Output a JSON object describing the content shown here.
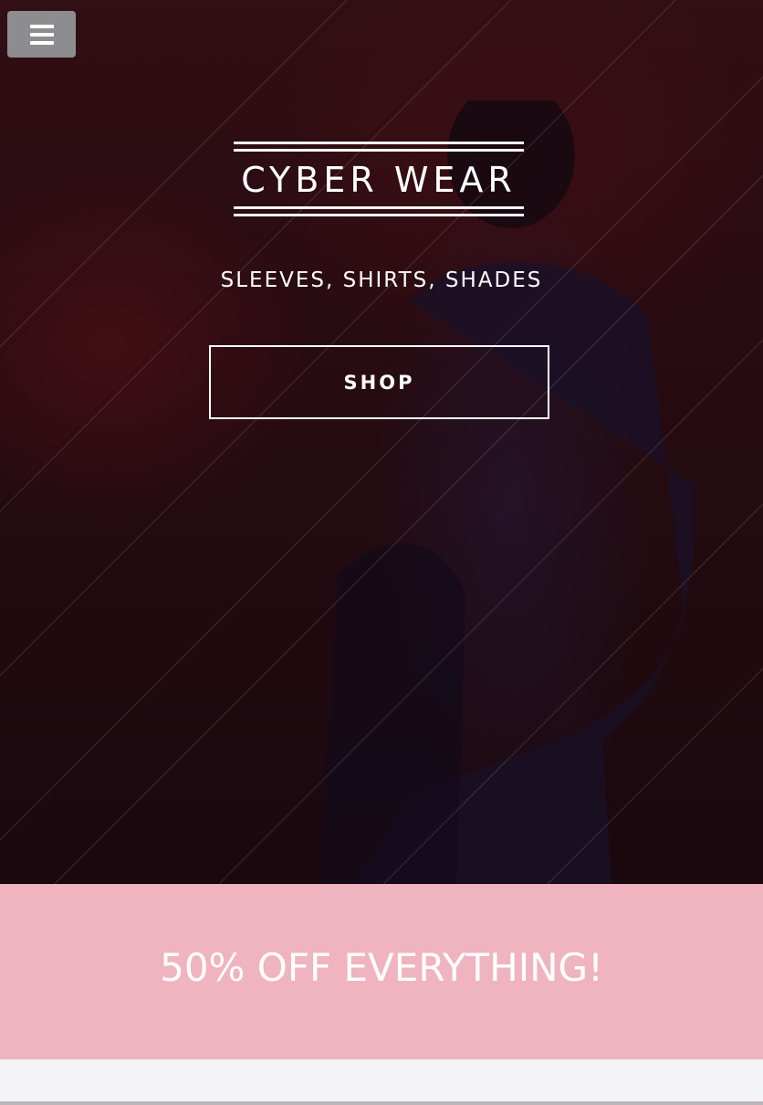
{
  "hero": {
    "brand_title": "CYBER WEAR",
    "tagline": "SLEEVES, SHIRTS, SHADES",
    "shop_label": "SHOP"
  },
  "nav": {
    "menu_icon": "hamburger-menu-icon"
  },
  "promo": {
    "text": "50% OFF EVERYTHING!"
  },
  "colors": {
    "hero_background": "#2c0e14",
    "promo_background": "#f0b3c0",
    "menu_button": "#8d8d8f",
    "text": "#ffffff"
  }
}
